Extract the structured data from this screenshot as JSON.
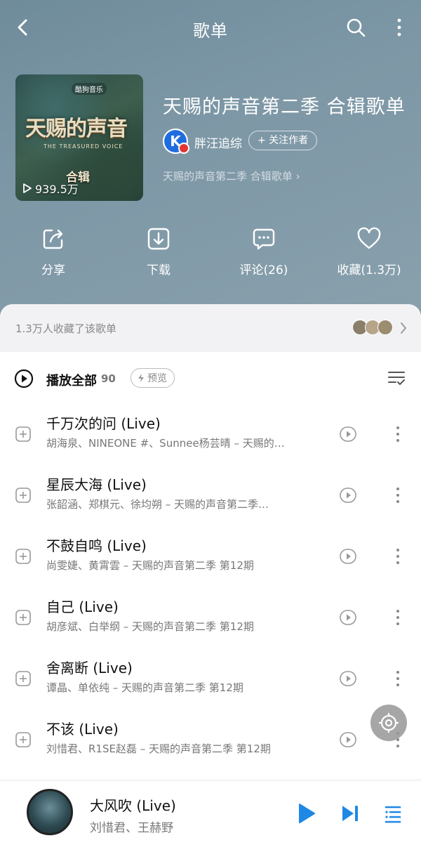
{
  "header": {
    "title": "歌单"
  },
  "playlist": {
    "title": "天赐的声音第二季 合辑歌单",
    "cover_badge": "酷狗音乐",
    "cover_logo": "天赐的声音",
    "cover_logo_sub": "THE TREASURED VOICE",
    "cover_label": "合辑",
    "plays": "939.5万",
    "author": "胖汪追综",
    "follow_label": "+ 关注作者",
    "description": "天赐的声音第二季 合辑歌单"
  },
  "actions": {
    "share": "分享",
    "download": "下载",
    "comment": "评论(26)",
    "favorite": "收藏(1.3万)"
  },
  "fans": {
    "text": "1.3万人收藏了该歌单"
  },
  "list_header": {
    "play_all": "播放全部",
    "count": "90",
    "preview": "预览"
  },
  "songs": [
    {
      "title": "千万次的问 (Live)",
      "meta": "胡海泉、NINEONE #、Sunnee杨芸晴 – 天赐的…"
    },
    {
      "title": "星辰大海 (Live)",
      "meta": "张韶涵、郑棋元、徐均朔 – 天赐的声音第二季…"
    },
    {
      "title": "不鼓自鸣 (Live)",
      "meta": "尚雯婕、黄霄雲 – 天赐的声音第二季 第12期"
    },
    {
      "title": "自己 (Live)",
      "meta": "胡彦斌、白举纲 – 天赐的声音第二季 第12期"
    },
    {
      "title": "舍离断 (Live)",
      "meta": "谭晶、单依纯 – 天赐的声音第二季 第12期"
    },
    {
      "title": "不该 (Live)",
      "meta": "刘惜君、R1SE赵磊 – 天赐的声音第二季 第12期"
    }
  ],
  "now_playing": {
    "title": "大风吹 (Live)",
    "artist": "刘惜君、王赫野"
  },
  "colors": {
    "accent": "#1e88e5",
    "hero_bg": "#7d97a6",
    "brand_blue": "#1e6de0"
  }
}
